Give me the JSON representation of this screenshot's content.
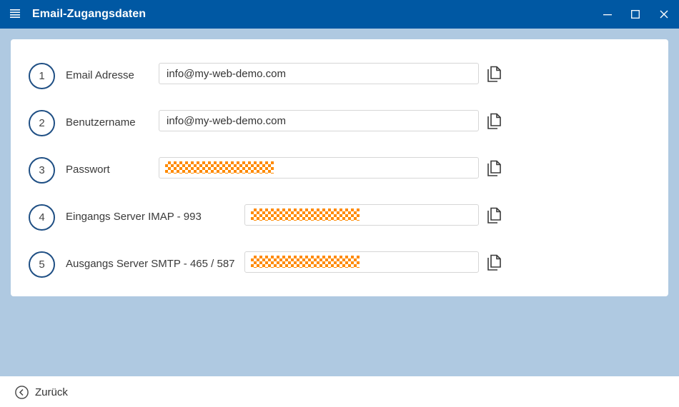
{
  "window": {
    "title": "Email-Zugangsdaten",
    "controls": [
      "minimize",
      "maximize",
      "close"
    ]
  },
  "rows": [
    {
      "number": "1",
      "label": "Email Adresse",
      "value": "info@my-web-demo.com",
      "masked": false
    },
    {
      "number": "2",
      "label": "Benutzername",
      "value": "info@my-web-demo.com",
      "masked": false
    },
    {
      "number": "3",
      "label": "Passwort",
      "value": "",
      "masked": true
    },
    {
      "number": "4",
      "label": "Eingangs Server IMAP - 993",
      "value": "",
      "masked": true
    },
    {
      "number": "5",
      "label": "Ausgangs Server SMTP - 465 / 587",
      "value": "",
      "masked": true
    }
  ],
  "footer": {
    "back_label": "Zurück"
  },
  "colors": {
    "titlebar": "#0058a3",
    "background": "#afc9e1",
    "circle_border": "#1f4f84",
    "mask": "#ff8a00"
  }
}
